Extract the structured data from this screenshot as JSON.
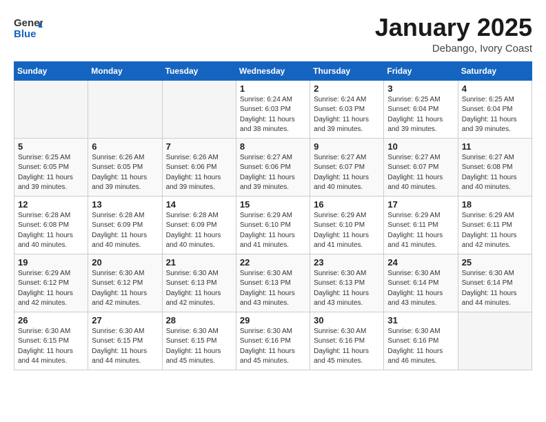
{
  "header": {
    "logo_general": "General",
    "logo_blue": "Blue",
    "month_title": "January 2025",
    "location": "Debango, Ivory Coast"
  },
  "days_of_week": [
    "Sunday",
    "Monday",
    "Tuesday",
    "Wednesday",
    "Thursday",
    "Friday",
    "Saturday"
  ],
  "weeks": [
    [
      {
        "day": "",
        "info": ""
      },
      {
        "day": "",
        "info": ""
      },
      {
        "day": "",
        "info": ""
      },
      {
        "day": "1",
        "info": "Sunrise: 6:24 AM\nSunset: 6:03 PM\nDaylight: 11 hours\nand 38 minutes."
      },
      {
        "day": "2",
        "info": "Sunrise: 6:24 AM\nSunset: 6:03 PM\nDaylight: 11 hours\nand 39 minutes."
      },
      {
        "day": "3",
        "info": "Sunrise: 6:25 AM\nSunset: 6:04 PM\nDaylight: 11 hours\nand 39 minutes."
      },
      {
        "day": "4",
        "info": "Sunrise: 6:25 AM\nSunset: 6:04 PM\nDaylight: 11 hours\nand 39 minutes."
      }
    ],
    [
      {
        "day": "5",
        "info": "Sunrise: 6:25 AM\nSunset: 6:05 PM\nDaylight: 11 hours\nand 39 minutes."
      },
      {
        "day": "6",
        "info": "Sunrise: 6:26 AM\nSunset: 6:05 PM\nDaylight: 11 hours\nand 39 minutes."
      },
      {
        "day": "7",
        "info": "Sunrise: 6:26 AM\nSunset: 6:06 PM\nDaylight: 11 hours\nand 39 minutes."
      },
      {
        "day": "8",
        "info": "Sunrise: 6:27 AM\nSunset: 6:06 PM\nDaylight: 11 hours\nand 39 minutes."
      },
      {
        "day": "9",
        "info": "Sunrise: 6:27 AM\nSunset: 6:07 PM\nDaylight: 11 hours\nand 40 minutes."
      },
      {
        "day": "10",
        "info": "Sunrise: 6:27 AM\nSunset: 6:07 PM\nDaylight: 11 hours\nand 40 minutes."
      },
      {
        "day": "11",
        "info": "Sunrise: 6:27 AM\nSunset: 6:08 PM\nDaylight: 11 hours\nand 40 minutes."
      }
    ],
    [
      {
        "day": "12",
        "info": "Sunrise: 6:28 AM\nSunset: 6:08 PM\nDaylight: 11 hours\nand 40 minutes."
      },
      {
        "day": "13",
        "info": "Sunrise: 6:28 AM\nSunset: 6:09 PM\nDaylight: 11 hours\nand 40 minutes."
      },
      {
        "day": "14",
        "info": "Sunrise: 6:28 AM\nSunset: 6:09 PM\nDaylight: 11 hours\nand 40 minutes."
      },
      {
        "day": "15",
        "info": "Sunrise: 6:29 AM\nSunset: 6:10 PM\nDaylight: 11 hours\nand 41 minutes."
      },
      {
        "day": "16",
        "info": "Sunrise: 6:29 AM\nSunset: 6:10 PM\nDaylight: 11 hours\nand 41 minutes."
      },
      {
        "day": "17",
        "info": "Sunrise: 6:29 AM\nSunset: 6:11 PM\nDaylight: 11 hours\nand 41 minutes."
      },
      {
        "day": "18",
        "info": "Sunrise: 6:29 AM\nSunset: 6:11 PM\nDaylight: 11 hours\nand 42 minutes."
      }
    ],
    [
      {
        "day": "19",
        "info": "Sunrise: 6:29 AM\nSunset: 6:12 PM\nDaylight: 11 hours\nand 42 minutes."
      },
      {
        "day": "20",
        "info": "Sunrise: 6:30 AM\nSunset: 6:12 PM\nDaylight: 11 hours\nand 42 minutes."
      },
      {
        "day": "21",
        "info": "Sunrise: 6:30 AM\nSunset: 6:13 PM\nDaylight: 11 hours\nand 42 minutes."
      },
      {
        "day": "22",
        "info": "Sunrise: 6:30 AM\nSunset: 6:13 PM\nDaylight: 11 hours\nand 43 minutes."
      },
      {
        "day": "23",
        "info": "Sunrise: 6:30 AM\nSunset: 6:13 PM\nDaylight: 11 hours\nand 43 minutes."
      },
      {
        "day": "24",
        "info": "Sunrise: 6:30 AM\nSunset: 6:14 PM\nDaylight: 11 hours\nand 43 minutes."
      },
      {
        "day": "25",
        "info": "Sunrise: 6:30 AM\nSunset: 6:14 PM\nDaylight: 11 hours\nand 44 minutes."
      }
    ],
    [
      {
        "day": "26",
        "info": "Sunrise: 6:30 AM\nSunset: 6:15 PM\nDaylight: 11 hours\nand 44 minutes."
      },
      {
        "day": "27",
        "info": "Sunrise: 6:30 AM\nSunset: 6:15 PM\nDaylight: 11 hours\nand 44 minutes."
      },
      {
        "day": "28",
        "info": "Sunrise: 6:30 AM\nSunset: 6:15 PM\nDaylight: 11 hours\nand 45 minutes."
      },
      {
        "day": "29",
        "info": "Sunrise: 6:30 AM\nSunset: 6:16 PM\nDaylight: 11 hours\nand 45 minutes."
      },
      {
        "day": "30",
        "info": "Sunrise: 6:30 AM\nSunset: 6:16 PM\nDaylight: 11 hours\nand 45 minutes."
      },
      {
        "day": "31",
        "info": "Sunrise: 6:30 AM\nSunset: 6:16 PM\nDaylight: 11 hours\nand 46 minutes."
      },
      {
        "day": "",
        "info": ""
      }
    ]
  ]
}
